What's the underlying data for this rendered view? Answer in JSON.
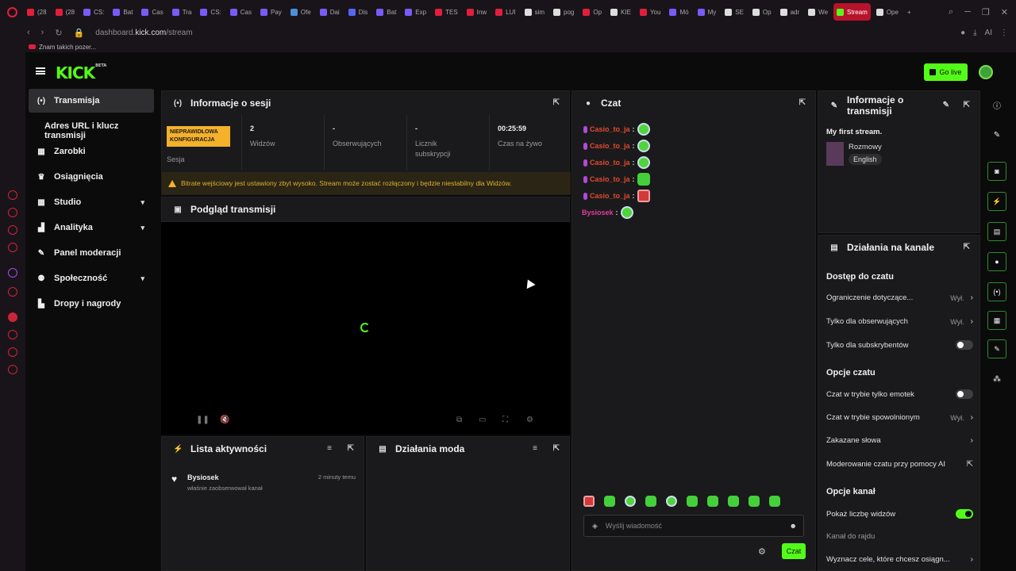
{
  "browser": {
    "tabs": [
      {
        "label": "(28",
        "color": "#e0203a"
      },
      {
        "label": "(28",
        "color": "#e0203a"
      },
      {
        "label": "CS:",
        "color": "#7a5af8"
      },
      {
        "label": "Bat",
        "color": "#7a5af8"
      },
      {
        "label": "Cas",
        "color": "#7a5af8"
      },
      {
        "label": "Tra",
        "color": "#7a5af8"
      },
      {
        "label": "CS:",
        "color": "#7a5af8"
      },
      {
        "label": "Cas",
        "color": "#7a5af8"
      },
      {
        "label": "Pay",
        "color": "#7a5af8"
      },
      {
        "label": "Ofe",
        "color": "#4a90d9"
      },
      {
        "label": "Dai",
        "color": "#7a5af8"
      },
      {
        "label": "Dis",
        "color": "#5865f2"
      },
      {
        "label": "Bat",
        "color": "#7a5af8"
      },
      {
        "label": "Exp",
        "color": "#7a5af8"
      },
      {
        "label": "TES",
        "color": "#e0203a"
      },
      {
        "label": "Inw",
        "color": "#e0203a"
      },
      {
        "label": "LUI",
        "color": "#e0203a"
      },
      {
        "label": "sim",
        "color": "#dddddd"
      },
      {
        "label": "pog",
        "color": "#dddddd"
      },
      {
        "label": "Op",
        "color": "#e0203a"
      },
      {
        "label": "KIE",
        "color": "#dddddd"
      },
      {
        "label": "You",
        "color": "#e0203a"
      },
      {
        "label": "Mó",
        "color": "#7a5af8"
      },
      {
        "label": "My",
        "color": "#7a5af8"
      },
      {
        "label": "SE",
        "color": "#dddddd"
      },
      {
        "label": "Op",
        "color": "#dddddd"
      },
      {
        "label": "adr",
        "color": "#dddddd"
      },
      {
        "label": "We",
        "color": "#dddddd"
      },
      {
        "label": "Stream",
        "color": "#53fc18",
        "active": true
      },
      {
        "label": "Ope",
        "color": "#dddddd"
      }
    ],
    "url_prefix": "dashboard.",
    "url_domain": "kick.com",
    "url_path": "/stream",
    "bookmark": "Znam takich pozer...",
    "ai_label": "AI"
  },
  "topbar": {
    "logo": "KICK",
    "logo_badge": "BETA",
    "golive_label": "Go live"
  },
  "sidebar": {
    "items": [
      {
        "label": "Transmisja",
        "icon": "broadcast-icon",
        "glyph": "(•)"
      },
      {
        "label": "Zarobki",
        "icon": "chart-icon",
        "glyph": "▦"
      },
      {
        "label": "Osiągnięcia",
        "icon": "trophy-icon",
        "glyph": "♛"
      },
      {
        "label": "Studio",
        "icon": "grid-icon",
        "glyph": "▦"
      },
      {
        "label": "Analityka",
        "icon": "analytics-icon",
        "glyph": "▟"
      },
      {
        "label": "Panel moderacji",
        "icon": "wrench-icon",
        "glyph": "✎"
      },
      {
        "label": "Społeczność",
        "icon": "people-icon",
        "glyph": "⚉"
      },
      {
        "label": "Dropy i nagrody",
        "icon": "gift-icon",
        "glyph": "▙"
      }
    ],
    "sub_item": "Adres URL i klucz transmisji",
    "chevron": "▾"
  },
  "session": {
    "title": "Informacje o sesji",
    "badge": "NIEPRAWIDŁOWA KONFIGURACJA",
    "badge_label": "Sesja",
    "stats": [
      {
        "value": "2",
        "label": "Widzów"
      },
      {
        "value": "-",
        "label": "Obserwujących"
      },
      {
        "value": "-",
        "label": "Licznik subskrypcji"
      },
      {
        "value": "00:25:59",
        "label": "Czas na żywo"
      }
    ],
    "warning": "Bitrate wejściowy jest ustawiony zbyt wysoko. Stream może zostać rozłączony i będzie niestabilny dla Widzów."
  },
  "preview": {
    "title": "Podgląd transmisji"
  },
  "activity": {
    "title": "Lista aktywności",
    "items": [
      {
        "user": "Bysiosek",
        "time": "2 minuty temu",
        "text": "właśnie zaobserwował kanał"
      }
    ]
  },
  "mod_actions": {
    "title": "Działania moda"
  },
  "chat": {
    "title": "Czat",
    "messages": [
      {
        "user": "Casio_to_ja",
        "emote": "laugh"
      },
      {
        "user": "Casio_to_ja",
        "emote": "laugh"
      },
      {
        "user": "Casio_to_ja",
        "emote": "laugh"
      },
      {
        "user": "Casio_to_ja",
        "emote": "green"
      },
      {
        "user": "Casio_to_ja",
        "emote": "red"
      },
      {
        "user": "Bysiosek",
        "emote": "laugh"
      }
    ],
    "placeholder": "Wyślij wiadomość",
    "send_label": "Czat"
  },
  "stream_info": {
    "title": "Informacje o transmisji",
    "stream_title": "My first stream.",
    "category": "Rozmowy",
    "language": "English"
  },
  "channel_actions": {
    "title": "Działania na kanale",
    "sections": [
      {
        "heading": "Dostęp do czatu",
        "rows": [
          {
            "label": "Ograniczenie dotyczące...",
            "value": "Wył.",
            "type": "arrow"
          },
          {
            "label": "Tylko dla obserwujących",
            "value": "Wył.",
            "type": "arrow"
          },
          {
            "label": "Tylko dla subskrybentów",
            "type": "toggle",
            "on": false
          }
        ]
      },
      {
        "heading": "Opcje czatu",
        "rows": [
          {
            "label": "Czat w trybie tylko emotek",
            "type": "toggle",
            "on": false
          },
          {
            "label": "Czat w trybie spowolnionym",
            "value": "Wył.",
            "type": "arrow"
          },
          {
            "label": "Zakazane słowa",
            "type": "arrow"
          },
          {
            "label": "Moderowanie czatu przy pomocy AI",
            "type": "external"
          }
        ]
      },
      {
        "heading": "Opcje kanał",
        "rows": [
          {
            "label": "Pokaż liczbę widzów",
            "type": "toggle",
            "on": true
          },
          {
            "label": "Kanał do rajdu",
            "type": "muted"
          },
          {
            "label": "Wyznacz cele, które chcesz osiągn...",
            "type": "arrow"
          }
        ]
      }
    ]
  }
}
